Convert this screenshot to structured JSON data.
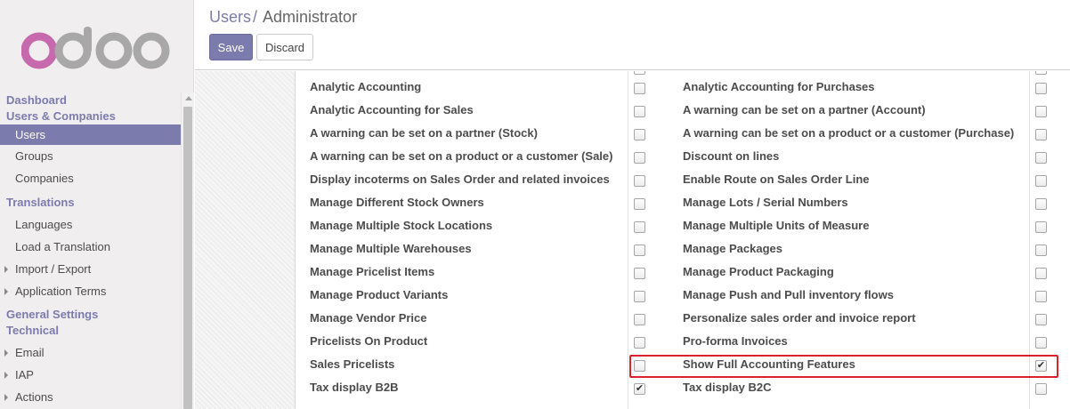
{
  "sidebar": {
    "logo": "odoo",
    "sections": {
      "dashboard": "Dashboard",
      "users_companies": "Users & Companies",
      "translations": "Translations",
      "general_settings": "General Settings",
      "technical": "Technical"
    },
    "items": {
      "users": "Users",
      "groups": "Groups",
      "companies": "Companies",
      "languages": "Languages",
      "load_translation": "Load a Translation",
      "import_export": "Import / Export",
      "application_terms": "Application Terms",
      "email": "Email",
      "iap": "IAP",
      "actions": "Actions"
    },
    "active_item": "Users"
  },
  "header": {
    "breadcrumb_parent": "Users",
    "breadcrumb_sep": "/",
    "breadcrumb_current": "Administrator",
    "save_label": "Save",
    "discard_label": "Discard"
  },
  "settings": {
    "left": [
      {
        "label": "Analytic Accounting",
        "checked": false
      },
      {
        "label": "Analytic Accounting for Sales",
        "checked": false
      },
      {
        "label": "A warning can be set on a partner (Stock)",
        "checked": false
      },
      {
        "label": "A warning can be set on a product or a customer (Sale)",
        "checked": false
      },
      {
        "label": "Display incoterms on Sales Order and related invoices",
        "checked": false
      },
      {
        "label": "Manage Different Stock Owners",
        "checked": false
      },
      {
        "label": "Manage Multiple Stock Locations",
        "checked": false
      },
      {
        "label": "Manage Multiple Warehouses",
        "checked": false
      },
      {
        "label": "Manage Pricelist Items",
        "checked": false
      },
      {
        "label": "Manage Product Variants",
        "checked": false
      },
      {
        "label": "Manage Vendor Price",
        "checked": false
      },
      {
        "label": "Pricelists On Product",
        "checked": false
      },
      {
        "label": "Sales Pricelists",
        "checked": false
      },
      {
        "label": "Tax display B2B",
        "checked": true
      }
    ],
    "right": [
      {
        "label": "Analytic Accounting for Purchases",
        "checked": false
      },
      {
        "label": "A warning can be set on a partner (Account)",
        "checked": false
      },
      {
        "label": "A warning can be set on a product or a customer (Purchase)",
        "checked": false
      },
      {
        "label": "Discount on lines",
        "checked": false
      },
      {
        "label": "Enable Route on Sales Order Line",
        "checked": false
      },
      {
        "label": "Manage Lots / Serial Numbers",
        "checked": false
      },
      {
        "label": "Manage Multiple Units of Measure",
        "checked": false
      },
      {
        "label": "Manage Packages",
        "checked": false
      },
      {
        "label": "Manage Product Packaging",
        "checked": false
      },
      {
        "label": "Manage Push and Pull inventory flows",
        "checked": false
      },
      {
        "label": "Personalize sales order and invoice report",
        "checked": false
      },
      {
        "label": "Pro-forma Invoices",
        "checked": false
      },
      {
        "label": "Show Full Accounting Features",
        "checked": true
      },
      {
        "label": "Tax display B2C",
        "checked": false
      }
    ]
  },
  "colors": {
    "brand": "#7c7bad",
    "highlight": "#d9232e",
    "logo_o": "#c66aad",
    "logo_rest": "#a8a8a8"
  },
  "icons": {
    "checkmark": "✔",
    "caret": "caret-right-icon"
  }
}
